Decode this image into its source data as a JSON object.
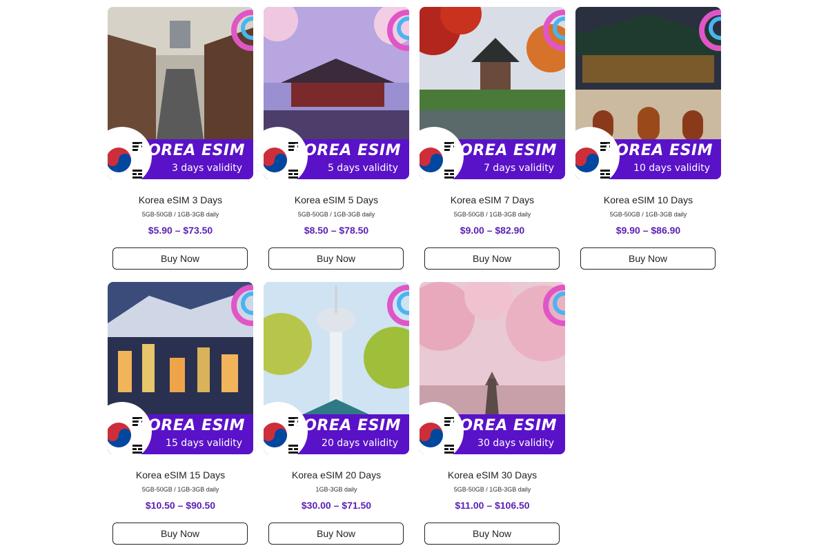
{
  "products": [
    {
      "brand": "KOREA ESIM",
      "validity": "3 days validity",
      "title": "Korea eSIM 3 Days",
      "specs": "5GB-50GB / 1GB-3GB daily",
      "price": "$5.90 – $73.50",
      "button": "Buy Now"
    },
    {
      "brand": "KOREA ESIM",
      "validity": "5 days validity",
      "title": "Korea eSIM 5 Days",
      "specs": "5GB-50GB / 1GB-3GB daily",
      "price": "$8.50 – $78.50",
      "button": "Buy Now"
    },
    {
      "brand": "KOREA ESIM",
      "validity": "7 days validity",
      "title": "Korea eSIM 7 Days",
      "specs": "5GB-50GB / 1GB-3GB daily",
      "price": "$9.00 – $82.90",
      "button": "Buy Now"
    },
    {
      "brand": "KOREA ESIM",
      "validity": "10 days validity",
      "title": "Korea eSIM 10 Days",
      "specs": "5GB-50GB / 1GB-3GB daily",
      "price": "$9.90 – $86.90",
      "button": "Buy Now"
    },
    {
      "brand": "KOREA ESIM",
      "validity": "15 days validity",
      "title": "Korea eSIM 15 Days",
      "specs": "5GB-50GB / 1GB-3GB daily",
      "price": "$10.50 – $90.50",
      "button": "Buy Now"
    },
    {
      "brand": "KOREA ESIM",
      "validity": "20 days validity",
      "title": "Korea eSIM 20 Days",
      "specs": "1GB-3GB daily",
      "price": "$30.00 – $71.50",
      "button": "Buy Now"
    },
    {
      "brand": "KOREA ESIM",
      "validity": "30 days validity",
      "title": "Korea eSIM 30 Days",
      "specs": "5GB-50GB / 1GB-3GB daily",
      "price": "$11.00 – $106.50",
      "button": "Buy Now"
    }
  ],
  "colors": {
    "banner": "#5a12c8",
    "price": "#5a1fb3",
    "accent_pink": "#e056c6",
    "accent_blue": "#4bb4f0"
  },
  "icons": {
    "flag": "south-korea-flag-icon"
  }
}
